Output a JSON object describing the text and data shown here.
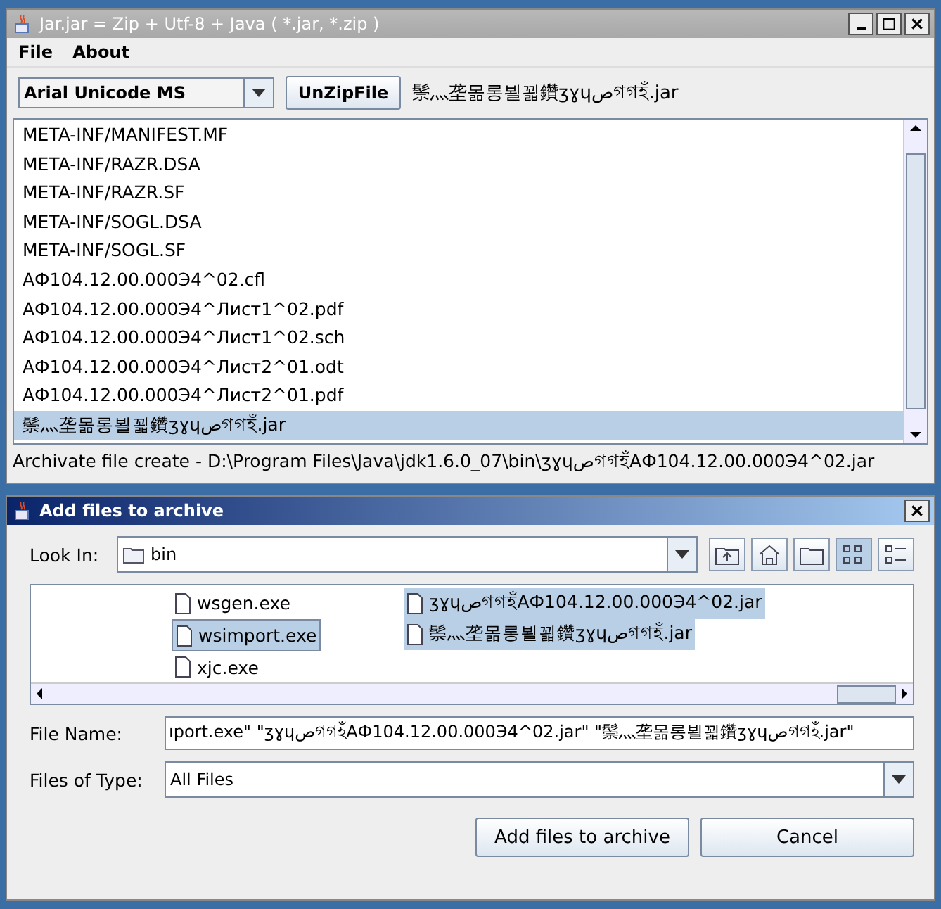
{
  "main_window": {
    "title": "Jar.jar = Zip + Utf-8 + Java ( *.jar, *.zip )",
    "menu": [
      "File",
      "About"
    ],
    "font_select": {
      "value": "Arial Unicode MS"
    },
    "unzip_button": "UnZipFile",
    "current_file": "鬃灬垄몲롱뵐꾋鑽ʒɣɥصগগহঁ.jar",
    "entries": [
      {
        "name": "META-INF/MANIFEST.MF",
        "selected": false
      },
      {
        "name": "META-INF/RAZR.DSA",
        "selected": false
      },
      {
        "name": "META-INF/RAZR.SF",
        "selected": false
      },
      {
        "name": "META-INF/SOGL.DSA",
        "selected": false
      },
      {
        "name": "META-INF/SOGL.SF",
        "selected": false
      },
      {
        "name": "АФ104.12.00.000Э4^02.cfl",
        "selected": false
      },
      {
        "name": "АФ104.12.00.000Э4^Лист1^02.pdf",
        "selected": false
      },
      {
        "name": "АФ104.12.00.000Э4^Лист1^02.sch",
        "selected": false
      },
      {
        "name": "АФ104.12.00.000Э4^Лист2^01.odt",
        "selected": false
      },
      {
        "name": "АФ104.12.00.000Э4^Лист2^01.pdf",
        "selected": false
      },
      {
        "name": "鬃灬垄몲롱뵐꾋鑽ʒɣɥصগগহঁ.jar",
        "selected": true
      }
    ],
    "status": "Archivate file create - D:\\Program Files\\Java\\jdk1.6.0_07\\bin\\ʒɣɥصগগহঁАФ104.12.00.000Э4^02.jar"
  },
  "dialog": {
    "title": "Add files to archive",
    "look_in_label": "Look In:",
    "look_in_value": "bin",
    "files_left": [
      {
        "name": "wsgen.exe",
        "selected": false
      },
      {
        "name": "wsimport.exe",
        "selected": true
      },
      {
        "name": "xjc.exe",
        "selected": false
      }
    ],
    "files_right": [
      {
        "name": "ʒɣɥصগগহঁАФ104.12.00.000Э4^02.jar",
        "selected": true
      },
      {
        "name": "鬃灬垄몲롱뵐꾋鑽ʒɣɥصগগহঁ.jar",
        "selected": true
      }
    ],
    "file_name_label": "File Name:",
    "file_name_value": "ıport.exe\" \"ʒɣɥصগগহঁАФ104.12.00.000Э4^02.jar\" \"鬃灬垄몲롱뵐꾋鑽ʒɣɥصগগহঁ.jar\"",
    "file_type_label": "Files of Type:",
    "file_type_value": "All Files",
    "buttons": [
      "Add files to archive",
      "Cancel"
    ]
  }
}
